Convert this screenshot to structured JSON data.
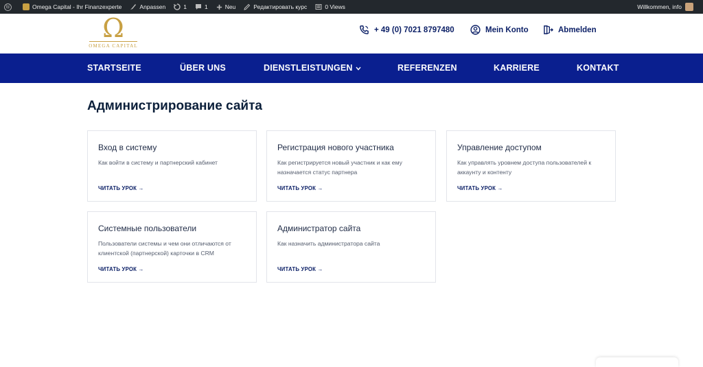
{
  "adminbar": {
    "site_name": "Omega Capital - Ihr Finanzexperte",
    "customize": "Anpassen",
    "updates_count": "1",
    "comments_count": "1",
    "new": "Neu",
    "edit": "Редактировать курс",
    "views": "0 Views",
    "greeting": "Willkommen, info"
  },
  "header": {
    "logo_symbol": "Ω",
    "logo_text": "OMEGA  CAPITAL",
    "phone": "+ 49 (0) 7021 8797480",
    "account": "Mein Konto",
    "logout": "Abmelden"
  },
  "nav": {
    "items": [
      "STARTSEITE",
      "ÜBER UNS",
      "DIENSTLEISTUNGEN",
      "REFERENZEN",
      "KARRIERE",
      "KONTAKT"
    ]
  },
  "main": {
    "title": "Администрирование сайта",
    "cards": [
      {
        "title": "Вход в систему",
        "desc": "Как войти в систему и партнерский кабинет",
        "link": "ЧИТАТЬ УРОК →"
      },
      {
        "title": "Регистрация нового участника",
        "desc": "Как регистрируется новый участник и как ему назначается статус партнера",
        "link": "ЧИТАТЬ УРОК →"
      },
      {
        "title": "Управление доступом",
        "desc": "Как управлять уровнем доступа пользователей к аккаунту и контенту",
        "link": "ЧИТАТЬ УРОК →"
      },
      {
        "title": "Системные пользователи",
        "desc": "Пользователи системы и чем они отличаются от клиентской (партнерской) карточки в CRM",
        "link": "ЧИТАТЬ УРОК →"
      },
      {
        "title": "Администратор сайта",
        "desc": "Как назначить администратора сайта",
        "link": "ЧИТАТЬ УРОК →"
      }
    ]
  },
  "colors": {
    "nav_bg": "#0a1f8f",
    "accent_gold": "#c8a043",
    "adminbar_bg": "#23282d",
    "text_dark": "#0b1f66"
  }
}
